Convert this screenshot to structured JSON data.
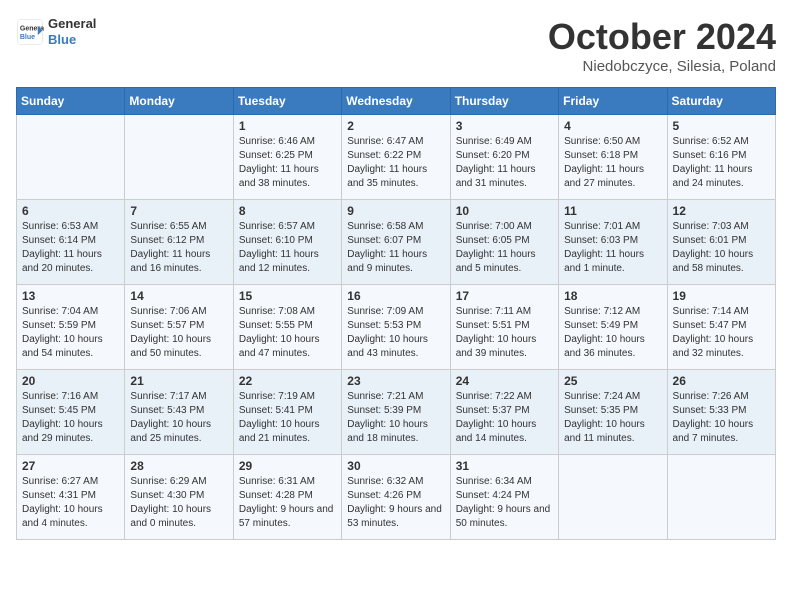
{
  "header": {
    "logo_general": "General",
    "logo_blue": "Blue",
    "month_title": "October 2024",
    "location": "Niedobczyce, Silesia, Poland"
  },
  "days_of_week": [
    "Sunday",
    "Monday",
    "Tuesday",
    "Wednesday",
    "Thursday",
    "Friday",
    "Saturday"
  ],
  "weeks": [
    [
      {
        "day": "",
        "sunrise": "",
        "sunset": "",
        "daylight": ""
      },
      {
        "day": "",
        "sunrise": "",
        "sunset": "",
        "daylight": ""
      },
      {
        "day": "1",
        "sunrise": "Sunrise: 6:46 AM",
        "sunset": "Sunset: 6:25 PM",
        "daylight": "Daylight: 11 hours and 38 minutes."
      },
      {
        "day": "2",
        "sunrise": "Sunrise: 6:47 AM",
        "sunset": "Sunset: 6:22 PM",
        "daylight": "Daylight: 11 hours and 35 minutes."
      },
      {
        "day": "3",
        "sunrise": "Sunrise: 6:49 AM",
        "sunset": "Sunset: 6:20 PM",
        "daylight": "Daylight: 11 hours and 31 minutes."
      },
      {
        "day": "4",
        "sunrise": "Sunrise: 6:50 AM",
        "sunset": "Sunset: 6:18 PM",
        "daylight": "Daylight: 11 hours and 27 minutes."
      },
      {
        "day": "5",
        "sunrise": "Sunrise: 6:52 AM",
        "sunset": "Sunset: 6:16 PM",
        "daylight": "Daylight: 11 hours and 24 minutes."
      }
    ],
    [
      {
        "day": "6",
        "sunrise": "Sunrise: 6:53 AM",
        "sunset": "Sunset: 6:14 PM",
        "daylight": "Daylight: 11 hours and 20 minutes."
      },
      {
        "day": "7",
        "sunrise": "Sunrise: 6:55 AM",
        "sunset": "Sunset: 6:12 PM",
        "daylight": "Daylight: 11 hours and 16 minutes."
      },
      {
        "day": "8",
        "sunrise": "Sunrise: 6:57 AM",
        "sunset": "Sunset: 6:10 PM",
        "daylight": "Daylight: 11 hours and 12 minutes."
      },
      {
        "day": "9",
        "sunrise": "Sunrise: 6:58 AM",
        "sunset": "Sunset: 6:07 PM",
        "daylight": "Daylight: 11 hours and 9 minutes."
      },
      {
        "day": "10",
        "sunrise": "Sunrise: 7:00 AM",
        "sunset": "Sunset: 6:05 PM",
        "daylight": "Daylight: 11 hours and 5 minutes."
      },
      {
        "day": "11",
        "sunrise": "Sunrise: 7:01 AM",
        "sunset": "Sunset: 6:03 PM",
        "daylight": "Daylight: 11 hours and 1 minute."
      },
      {
        "day": "12",
        "sunrise": "Sunrise: 7:03 AM",
        "sunset": "Sunset: 6:01 PM",
        "daylight": "Daylight: 10 hours and 58 minutes."
      }
    ],
    [
      {
        "day": "13",
        "sunrise": "Sunrise: 7:04 AM",
        "sunset": "Sunset: 5:59 PM",
        "daylight": "Daylight: 10 hours and 54 minutes."
      },
      {
        "day": "14",
        "sunrise": "Sunrise: 7:06 AM",
        "sunset": "Sunset: 5:57 PM",
        "daylight": "Daylight: 10 hours and 50 minutes."
      },
      {
        "day": "15",
        "sunrise": "Sunrise: 7:08 AM",
        "sunset": "Sunset: 5:55 PM",
        "daylight": "Daylight: 10 hours and 47 minutes."
      },
      {
        "day": "16",
        "sunrise": "Sunrise: 7:09 AM",
        "sunset": "Sunset: 5:53 PM",
        "daylight": "Daylight: 10 hours and 43 minutes."
      },
      {
        "day": "17",
        "sunrise": "Sunrise: 7:11 AM",
        "sunset": "Sunset: 5:51 PM",
        "daylight": "Daylight: 10 hours and 39 minutes."
      },
      {
        "day": "18",
        "sunrise": "Sunrise: 7:12 AM",
        "sunset": "Sunset: 5:49 PM",
        "daylight": "Daylight: 10 hours and 36 minutes."
      },
      {
        "day": "19",
        "sunrise": "Sunrise: 7:14 AM",
        "sunset": "Sunset: 5:47 PM",
        "daylight": "Daylight: 10 hours and 32 minutes."
      }
    ],
    [
      {
        "day": "20",
        "sunrise": "Sunrise: 7:16 AM",
        "sunset": "Sunset: 5:45 PM",
        "daylight": "Daylight: 10 hours and 29 minutes."
      },
      {
        "day": "21",
        "sunrise": "Sunrise: 7:17 AM",
        "sunset": "Sunset: 5:43 PM",
        "daylight": "Daylight: 10 hours and 25 minutes."
      },
      {
        "day": "22",
        "sunrise": "Sunrise: 7:19 AM",
        "sunset": "Sunset: 5:41 PM",
        "daylight": "Daylight: 10 hours and 21 minutes."
      },
      {
        "day": "23",
        "sunrise": "Sunrise: 7:21 AM",
        "sunset": "Sunset: 5:39 PM",
        "daylight": "Daylight: 10 hours and 18 minutes."
      },
      {
        "day": "24",
        "sunrise": "Sunrise: 7:22 AM",
        "sunset": "Sunset: 5:37 PM",
        "daylight": "Daylight: 10 hours and 14 minutes."
      },
      {
        "day": "25",
        "sunrise": "Sunrise: 7:24 AM",
        "sunset": "Sunset: 5:35 PM",
        "daylight": "Daylight: 10 hours and 11 minutes."
      },
      {
        "day": "26",
        "sunrise": "Sunrise: 7:26 AM",
        "sunset": "Sunset: 5:33 PM",
        "daylight": "Daylight: 10 hours and 7 minutes."
      }
    ],
    [
      {
        "day": "27",
        "sunrise": "Sunrise: 6:27 AM",
        "sunset": "Sunset: 4:31 PM",
        "daylight": "Daylight: 10 hours and 4 minutes."
      },
      {
        "day": "28",
        "sunrise": "Sunrise: 6:29 AM",
        "sunset": "Sunset: 4:30 PM",
        "daylight": "Daylight: 10 hours and 0 minutes."
      },
      {
        "day": "29",
        "sunrise": "Sunrise: 6:31 AM",
        "sunset": "Sunset: 4:28 PM",
        "daylight": "Daylight: 9 hours and 57 minutes."
      },
      {
        "day": "30",
        "sunrise": "Sunrise: 6:32 AM",
        "sunset": "Sunset: 4:26 PM",
        "daylight": "Daylight: 9 hours and 53 minutes."
      },
      {
        "day": "31",
        "sunrise": "Sunrise: 6:34 AM",
        "sunset": "Sunset: 4:24 PM",
        "daylight": "Daylight: 9 hours and 50 minutes."
      },
      {
        "day": "",
        "sunrise": "",
        "sunset": "",
        "daylight": ""
      },
      {
        "day": "",
        "sunrise": "",
        "sunset": "",
        "daylight": ""
      }
    ]
  ]
}
